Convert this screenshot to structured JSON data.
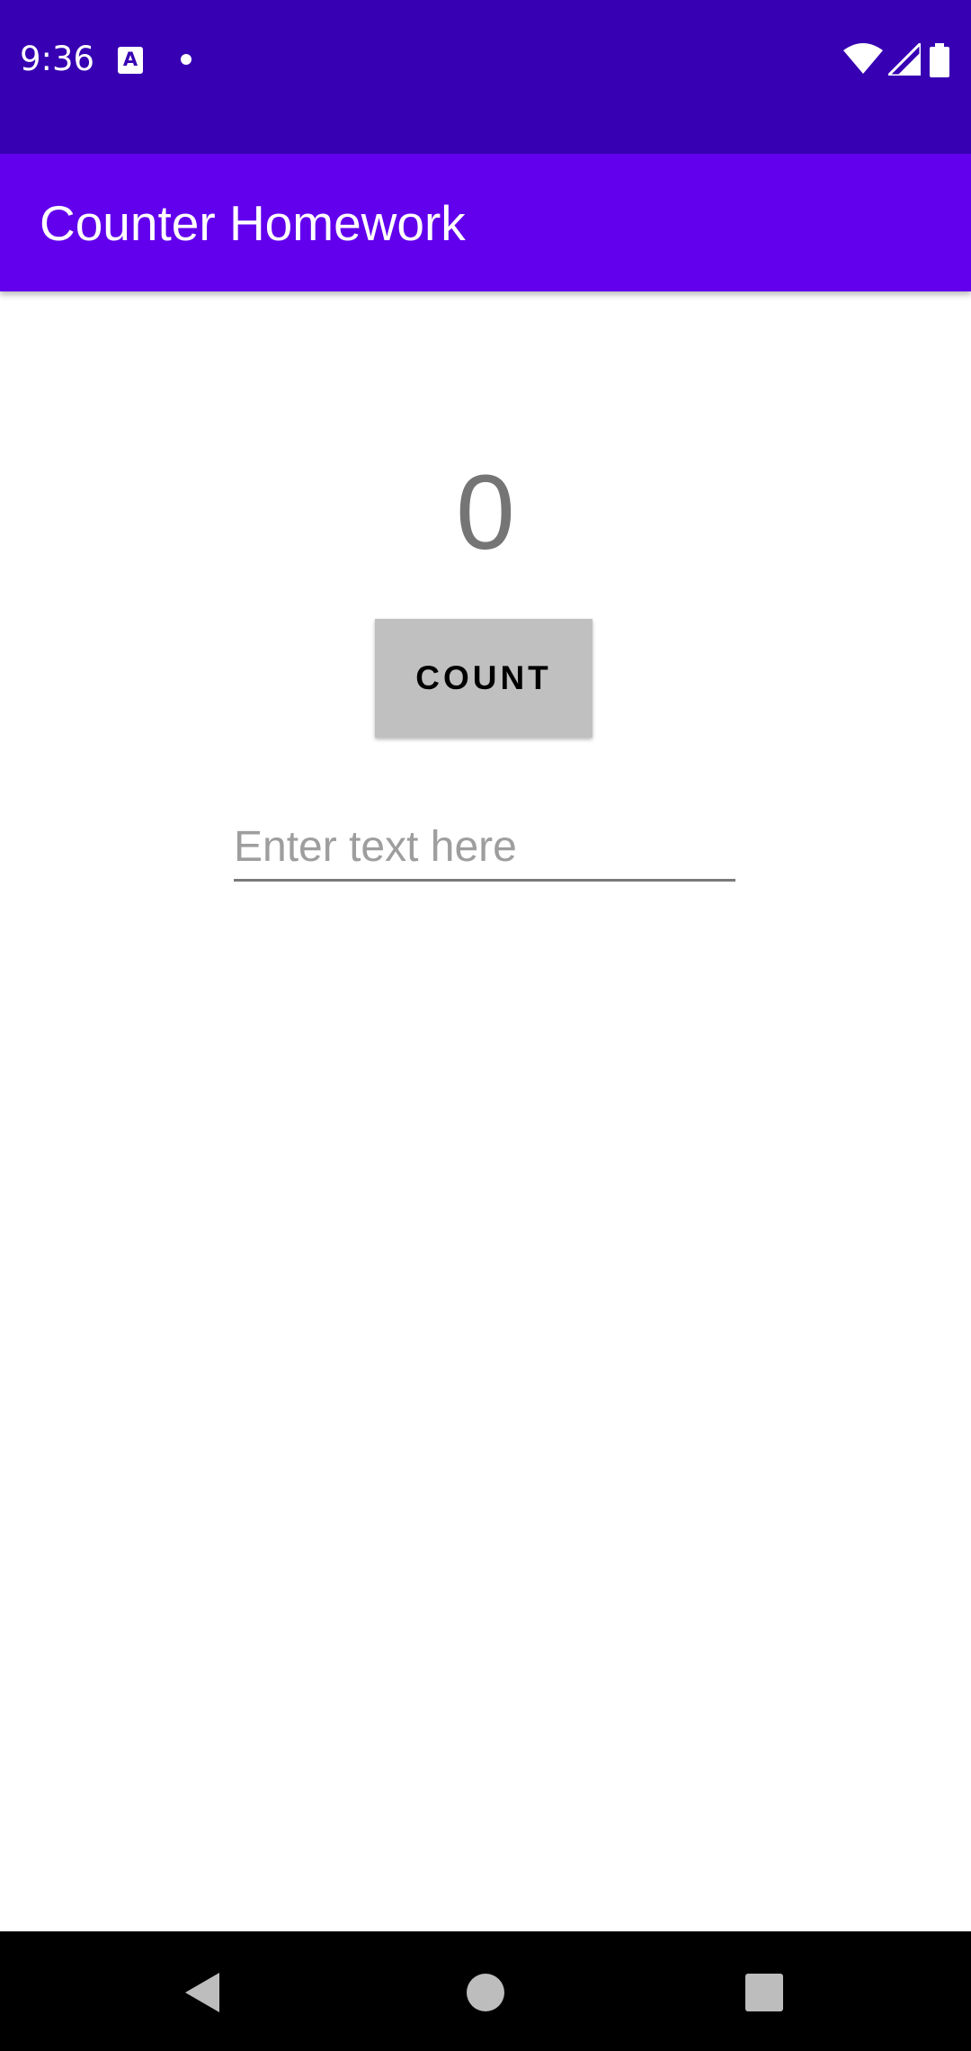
{
  "status_bar": {
    "time": "9:36",
    "notification_icon_letter": "A",
    "icons": [
      "wifi-icon",
      "cell-signal-icon",
      "battery-icon"
    ],
    "background": "#3700b3"
  },
  "app_bar": {
    "title": "Counter Homework",
    "background": "#6200ee"
  },
  "counter": {
    "value": "0"
  },
  "count_button": {
    "label": "COUNT",
    "background": "#c1c0c1"
  },
  "text_input": {
    "value": "",
    "placeholder": "Enter text here"
  },
  "nav_bar": {
    "buttons": [
      "back-icon",
      "home-icon",
      "recents-icon"
    ]
  }
}
